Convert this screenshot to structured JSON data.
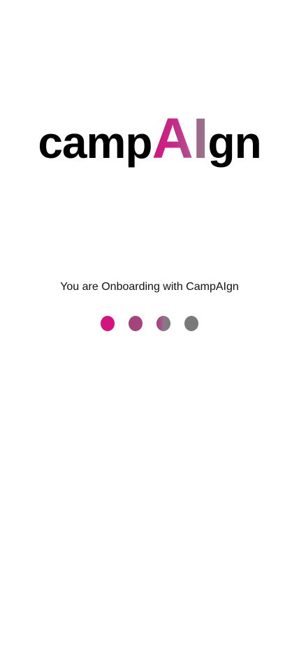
{
  "logo": {
    "prefix": "camp",
    "highlight": "AI",
    "suffix": "gn"
  },
  "subtitle": "You are Onboarding with CampAIgn",
  "progress": {
    "step_count": 4,
    "dot_colors": [
      "#d4137f",
      "#a3447d",
      "linear-gradient(90deg, #b82d84 0%, #8a7a86 55%, #7a7a7a 100%)",
      "#7a7a7a"
    ]
  },
  "colors": {
    "accent": "#d4137f",
    "muted": "#7a7a7a",
    "text": "#000000",
    "background": "#ffffff"
  }
}
